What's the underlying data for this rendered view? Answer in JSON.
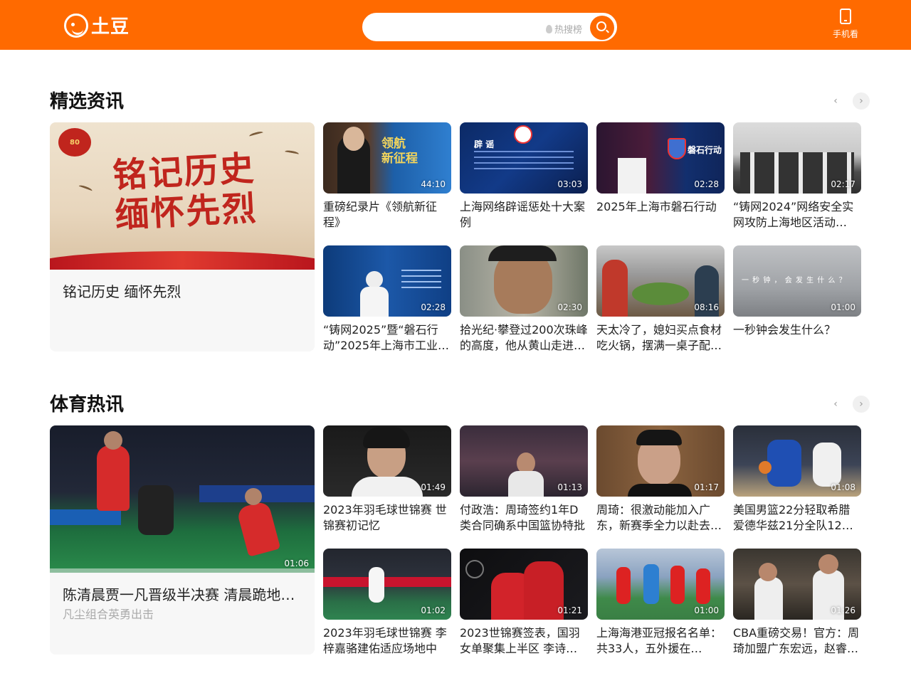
{
  "header": {
    "logo_text": "土豆",
    "search_placeholder": "",
    "hot_label": "热搜榜",
    "mobile_label": "手机看"
  },
  "colors": {
    "brand": "#ff6a00"
  },
  "sections": [
    {
      "title": "精选资讯",
      "feature": {
        "title": "铭记历史 缅怀先烈",
        "image_text": "铭记历史\n缅怀先烈",
        "badge": "80"
      },
      "cards": [
        {
          "title": "重磅纪录片《领航新征程》",
          "duration": "44:10",
          "overlay": "领航\n新征程"
        },
        {
          "title": "上海网络辟谣惩处十大案例",
          "duration": "03:03",
          "overlay": "辟 谣"
        },
        {
          "title": "2025年上海市磐石行动",
          "duration": "02:28",
          "overlay": "磐石行动"
        },
        {
          "title": "“铸网2024”网络安全实网攻防上海地区活动暨“…",
          "duration": "02:17",
          "overlay": ""
        },
        {
          "title": "“铸网2025”暨“磐石行动”2025年上海市工业…",
          "duration": "02:28",
          "overlay": ""
        },
        {
          "title": "拾光纪·攀登过200次珠峰的高度，他从黄山走进…",
          "duration": "02:30",
          "overlay": ""
        },
        {
          "title": "天太冷了，媳妇买点食材吃火锅，摆满一桌子配…",
          "duration": "08:16",
          "overlay": ""
        },
        {
          "title": "一秒钟会发生什么？",
          "duration": "01:00",
          "overlay": "一 秒 钟 ， 会 发 生 什 么 ？"
        }
      ]
    },
    {
      "title": "体育热讯",
      "feature": {
        "title": "陈清晨贾一凡晋级半决赛 清晨跪地…",
        "subtitle": "凡尘组合英勇出击",
        "duration": "01:06"
      },
      "cards": [
        {
          "title": "2023年羽毛球世锦赛 世锦赛初记忆",
          "duration": "01:49"
        },
        {
          "title": "付政浩：周琦签约1年D类合同确系中国篮协特批",
          "duration": "01:13"
        },
        {
          "title": "周琦：很激动能加入广东，新赛季全力以赴去…",
          "duration": "01:17"
        },
        {
          "title": "美国男篮22分轻取希腊 爱德华兹21分全队12人…",
          "duration": "01:08"
        },
        {
          "title": "2023年羽毛球世锦赛 李梓嘉骆建佑适应场地中",
          "duration": "01:02"
        },
        {
          "title": "2023世锦赛签表，国羽女单聚集上半区 李诗沣 …",
          "duration": "01:21"
        },
        {
          "title": "上海海港亚冠报名名单：共33人，五外援在列，…",
          "duration": "01:00"
        },
        {
          "title": "CBA重磅交易！官方：周琦加盟广东宏远，赵睿…",
          "duration": "01:26"
        }
      ]
    }
  ]
}
